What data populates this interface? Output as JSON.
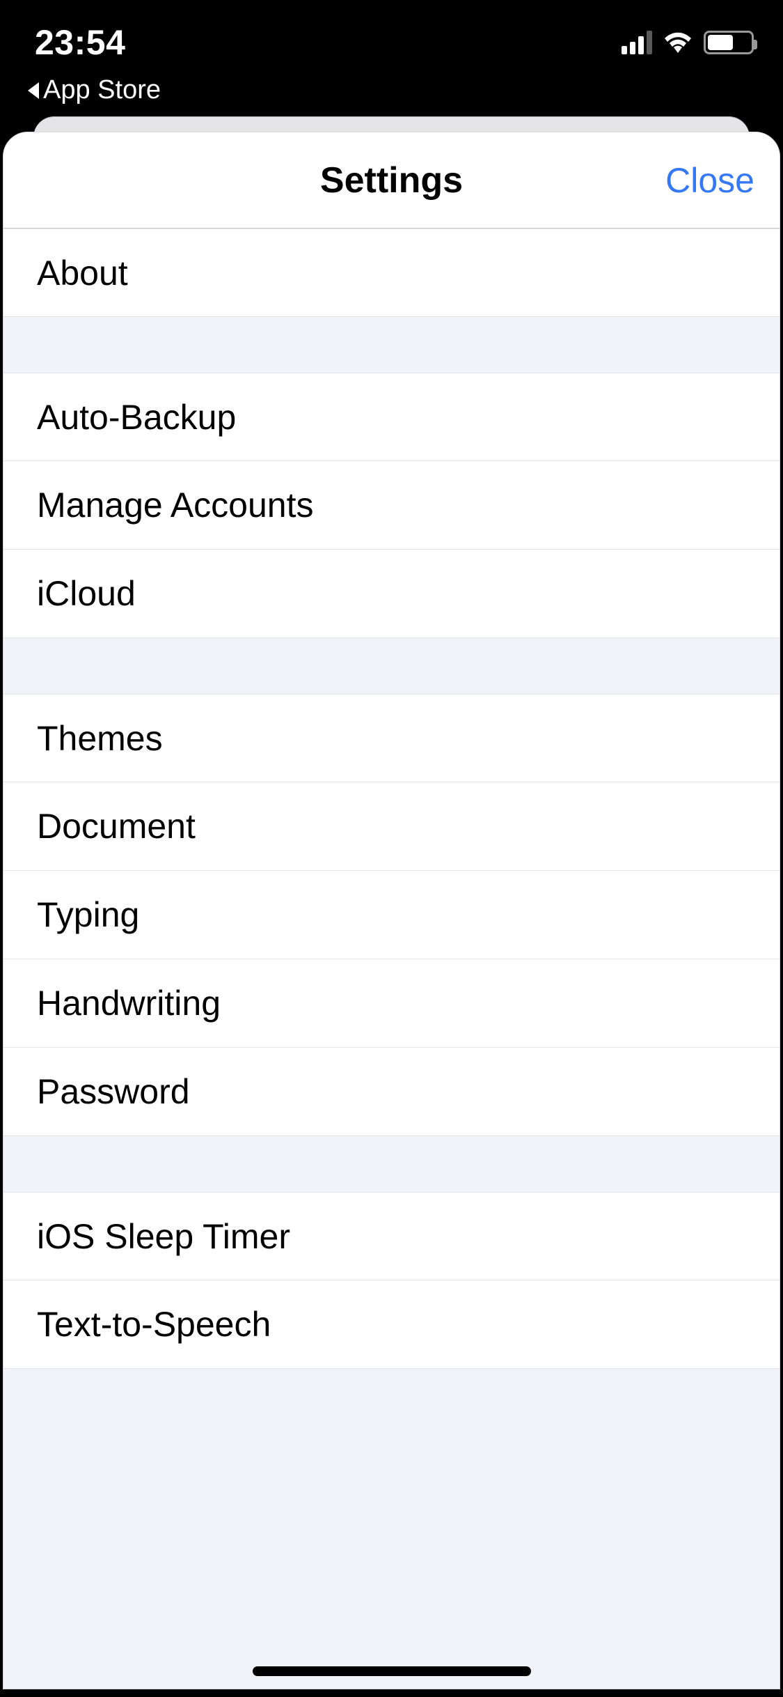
{
  "statusbar": {
    "time": "23:54",
    "cell_signal_bars": 3,
    "cell_signal_total": 4,
    "wifi_strength": 3,
    "battery_percent": 55
  },
  "breadcrumb": {
    "back_label": "App Store"
  },
  "modal": {
    "title": "Settings",
    "close_label": "Close"
  },
  "sections": [
    {
      "rows": [
        {
          "label": "About"
        }
      ]
    },
    {
      "rows": [
        {
          "label": "Auto-Backup"
        },
        {
          "label": "Manage Accounts"
        },
        {
          "label": "iCloud"
        }
      ]
    },
    {
      "rows": [
        {
          "label": "Themes"
        },
        {
          "label": "Document"
        },
        {
          "label": "Typing"
        },
        {
          "label": "Handwriting"
        },
        {
          "label": "Password"
        }
      ]
    },
    {
      "rows": [
        {
          "label": "iOS Sleep Timer"
        },
        {
          "label": "Text-to-Speech"
        }
      ]
    }
  ]
}
